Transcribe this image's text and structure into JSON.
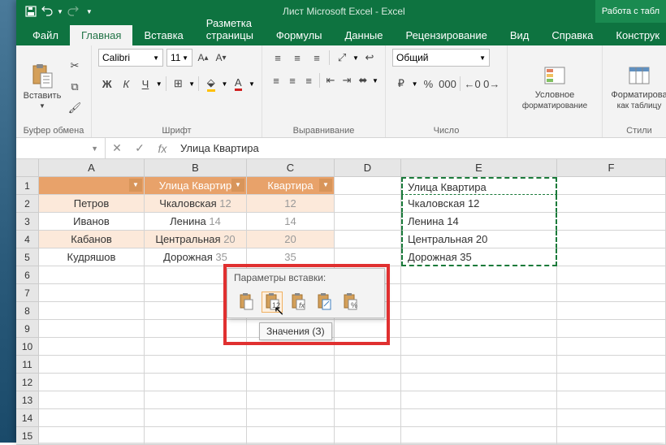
{
  "title": "Лист Microsoft Excel  -  Excel",
  "titlebar_right": "Работа с табл",
  "tabs": {
    "file": "Файл",
    "home": "Главная",
    "insert": "Вставка",
    "layout": "Разметка страницы",
    "formulas": "Формулы",
    "data": "Данные",
    "review": "Рецензирование",
    "view": "Вид",
    "help": "Справка",
    "design": "Конструк"
  },
  "ribbon": {
    "clipboard": {
      "label": "Буфер обмена",
      "paste": "Вставить"
    },
    "font": {
      "label": "Шрифт",
      "name": "Calibri",
      "size": "11"
    },
    "alignment": {
      "label": "Выравнивание"
    },
    "number": {
      "label": "Число",
      "format": "Общий"
    },
    "cond": {
      "label": "Условное форматиров…",
      "label2": "Условное",
      "label3": "форматирование"
    },
    "format_table": {
      "label": "Форматирова",
      "label2": "как таблицу"
    },
    "styles": {
      "label": "Стили"
    }
  },
  "formula_bar": {
    "value": "Улица Квартира"
  },
  "columns": [
    "A",
    "B",
    "C",
    "D",
    "E",
    "F"
  ],
  "rows": [
    "1",
    "2",
    "3",
    "4",
    "5",
    "6",
    "7",
    "8",
    "9",
    "10",
    "11",
    "12",
    "13",
    "14",
    "15"
  ],
  "headers": {
    "b": "Улица Квартир",
    "c": "Квартира"
  },
  "table": [
    {
      "a": "Петров",
      "b_street": "Чкаловская",
      "b_num": "12",
      "c": "12"
    },
    {
      "a": "Иванов",
      "b_street": "Ленина",
      "b_num": "14",
      "c": "14"
    },
    {
      "a": "Кабанов",
      "b_street": "Центральная",
      "b_num": "20",
      "c": "20"
    },
    {
      "a": "Кудряшов",
      "b_street": "Дорожная",
      "b_num": "35",
      "c": "35"
    }
  ],
  "pasted": [
    "Улица Квартира",
    "Чкаловская 12",
    "Ленина 14",
    "Центральная 20",
    "Дорожная 35"
  ],
  "paste_popup": {
    "title": "Параметры вставки:",
    "tooltip": "Значения (З)"
  }
}
